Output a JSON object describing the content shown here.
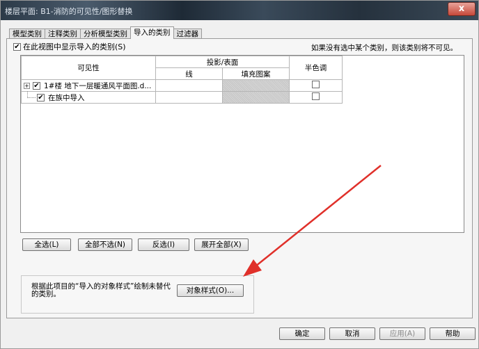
{
  "window": {
    "title": "楼层平面: B1-消防的可见性/图形替换",
    "close_label": "x"
  },
  "tabs": [
    {
      "label": "模型类别"
    },
    {
      "label": "注释类别"
    },
    {
      "label": "分析模型类别"
    },
    {
      "label": "导入的类别"
    },
    {
      "label": "过滤器"
    }
  ],
  "active_tab": "导入的类别",
  "show_imported": {
    "label": "在此视图中显示导入的类别(S)",
    "checked": true
  },
  "hint": "如果没有选中某个类别，则该类别将不可见。",
  "grid": {
    "headers": {
      "visibility": "可见性",
      "projection": "投影/表面",
      "line": "线",
      "fill": "填充图案",
      "halftone": "半色调"
    },
    "rows": [
      {
        "expander": "+",
        "checked": "✔",
        "name": "1#楼 地下一层暖通风平面图.d...",
        "halftone": false
      },
      {
        "expander": "",
        "checked": "✔",
        "name": "在族中导入",
        "halftone": false
      }
    ]
  },
  "buttons": {
    "select_all": "全选(L)",
    "select_none": "全部不选(N)",
    "invert": "反选(I)",
    "expand_all": "展开全部(X)",
    "object_styles": "对象样式(O)...",
    "ok": "确定",
    "cancel": "取消",
    "apply": "应用(A)",
    "help": "帮助"
  },
  "object_styles_desc": "根据此项目的“导入的对象样式”绘制未替代的类别。",
  "colors": {
    "annotation_arrow": "#e0302a"
  }
}
